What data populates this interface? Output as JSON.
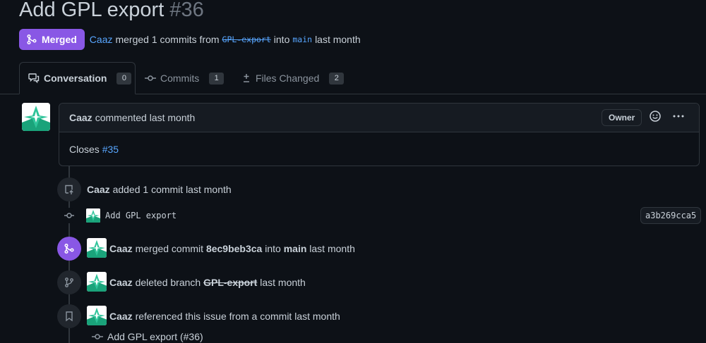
{
  "pr": {
    "title": "Add GPL export",
    "number": "#36",
    "status": "Merged",
    "author": "Caaz",
    "merged_text": "merged 1 commits from",
    "source_branch": "GPL-export",
    "into": "into",
    "target_branch": "main",
    "when": "last month"
  },
  "tabs": [
    {
      "label": "Conversation",
      "count": "0"
    },
    {
      "label": "Commits",
      "count": "1"
    },
    {
      "label": "Files Changed",
      "count": "2"
    }
  ],
  "comment": {
    "author": "Caaz",
    "action": "commented last month",
    "role": "Owner",
    "body_prefix": "Closes",
    "body_issue": "#35"
  },
  "timeline": {
    "added": {
      "author": "Caaz",
      "text": "added 1 commit last month"
    },
    "commit": {
      "message": "Add GPL export",
      "sha": "a3b269cca5"
    },
    "merged": {
      "author": "Caaz",
      "pre": "merged commit",
      "sha": "8ec9beb3ca",
      "mid": "into",
      "branch": "main",
      "when": "last month"
    },
    "deleted": {
      "author": "Caaz",
      "pre": "deleted branch",
      "branch": "GPL-export",
      "when": "last month"
    },
    "referenced": {
      "author": "Caaz",
      "text": "referenced this issue from a commit last month",
      "commit_message": "Add GPL export (#36)"
    }
  },
  "colors": {
    "merged": "#8957e5",
    "link": "#58a6ff",
    "background": "#0d1117",
    "border": "#30363d"
  },
  "icons": [
    "merge-icon",
    "comment-discussion-icon",
    "git-commit-icon",
    "file-diff-icon",
    "smiley-icon",
    "kebab-horizontal-icon",
    "repo-push-icon",
    "git-merge-icon",
    "git-branch-icon",
    "bookmark-icon",
    "avatar-logo"
  ]
}
